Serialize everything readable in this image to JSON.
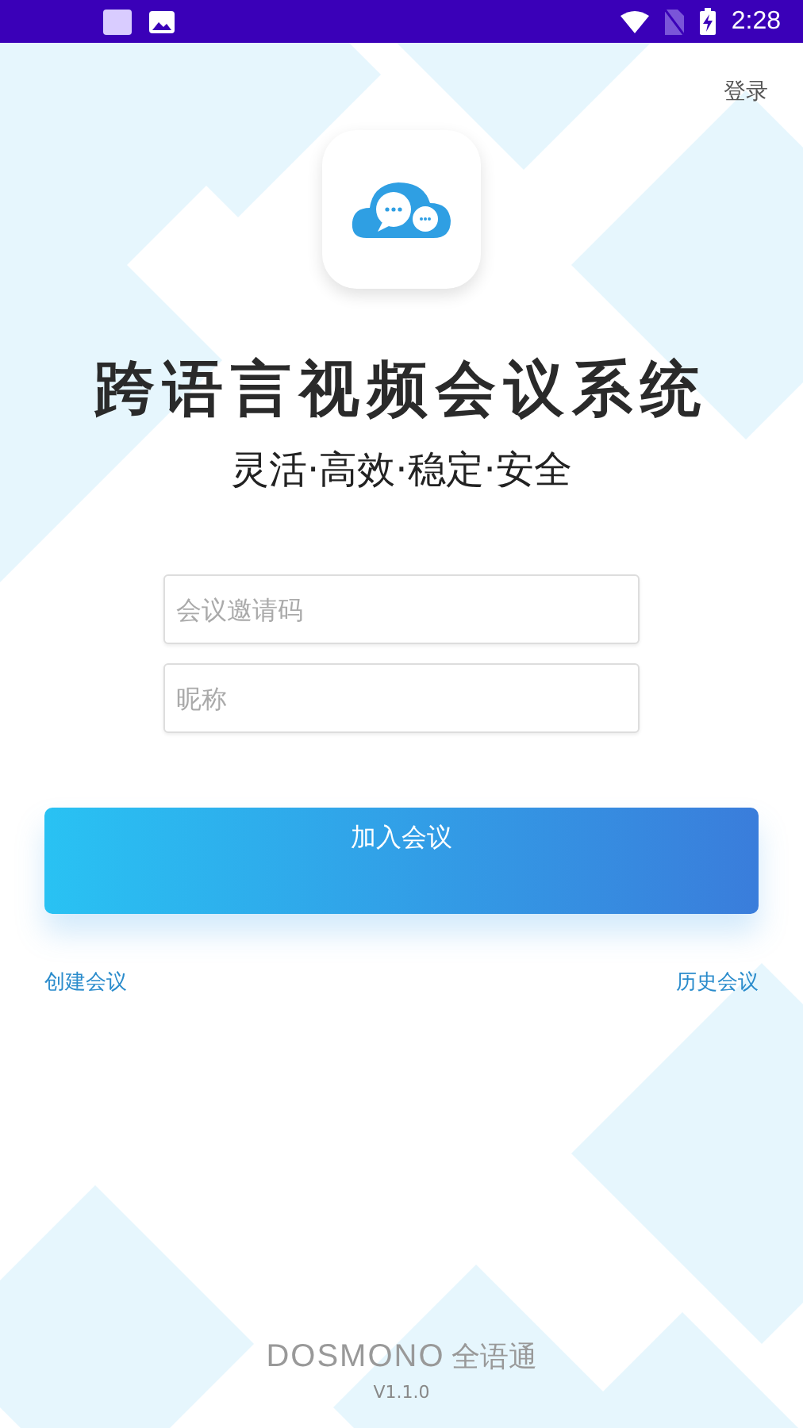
{
  "status_bar": {
    "time": "2:28"
  },
  "header": {
    "login_link": "登录"
  },
  "app": {
    "title": "跨语言视频会议系统",
    "tagline": "灵活·高效·稳定·安全"
  },
  "form": {
    "fields": [
      {
        "placeholder": "会议邀请码"
      },
      {
        "placeholder": "昵称"
      }
    ],
    "join_button": "加入会议"
  },
  "links": [
    "创建会议",
    "历史会议"
  ],
  "footer": {
    "brand": "DOSMONO",
    "brand_cn": "全语通",
    "version": "V1.1.0"
  }
}
